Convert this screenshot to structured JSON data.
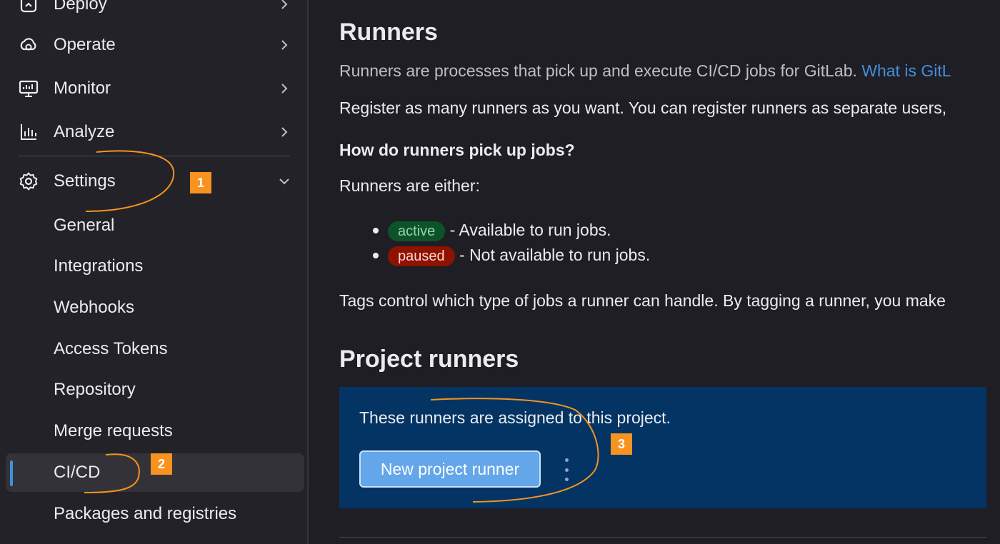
{
  "sidebar": {
    "top_items": [
      {
        "label": "Deploy",
        "icon": "deploy-icon"
      },
      {
        "label": "Operate",
        "icon": "cloud-gear-icon"
      },
      {
        "label": "Monitor",
        "icon": "monitor-icon"
      },
      {
        "label": "Analyze",
        "icon": "bar-chart-icon"
      }
    ],
    "settings": {
      "label": "Settings",
      "icon": "gear-icon",
      "expanded": true
    },
    "sub_items": [
      {
        "label": "General"
      },
      {
        "label": "Integrations"
      },
      {
        "label": "Webhooks"
      },
      {
        "label": "Access Tokens"
      },
      {
        "label": "Repository"
      },
      {
        "label": "Merge requests"
      },
      {
        "label": "CI/CD",
        "active": true
      },
      {
        "label": "Packages and registries"
      }
    ]
  },
  "main": {
    "title": "Runners",
    "intro_text": "Runners are processes that pick up and execute CI/CD jobs for GitLab.",
    "intro_link": "What is GitL",
    "register_text": "Register as many runners as you want. You can register runners as separate users,",
    "question": "How do runners pick up jobs?",
    "either_text": "Runners are either:",
    "states": [
      {
        "badge": "active",
        "desc": "- Available to run jobs."
      },
      {
        "badge": "paused",
        "desc": "- Not available to run jobs."
      }
    ],
    "tags_text": "Tags control which type of jobs a runner can handle. By tagging a runner, you make",
    "project_runners": {
      "title": "Project runners",
      "panel_text": "These runners are assigned to this project.",
      "new_button": "New project runner",
      "more_icon": "kebab-menu-icon"
    }
  },
  "annotations": [
    "1",
    "2",
    "3"
  ],
  "colors": {
    "background": "#1f1e24",
    "sidebar": "#232228",
    "link": "#428fdc",
    "panel": "#033464",
    "button": "#63a6e9",
    "annotation": "#f7931e",
    "active_badge": "#0d532a",
    "paused_badge": "#8d1300"
  }
}
